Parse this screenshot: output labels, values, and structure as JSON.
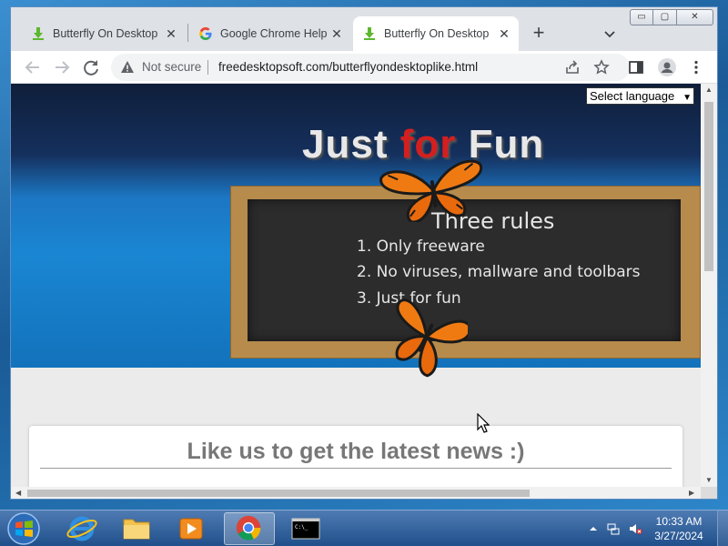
{
  "browser": {
    "tabs": [
      {
        "title": "Butterfly On Desktop on",
        "favicon": "download-icon",
        "active": false
      },
      {
        "title": "Google Chrome Help",
        "favicon": "google-icon",
        "active": false
      },
      {
        "title": "Butterfly On Desktop",
        "favicon": "download-icon",
        "active": true
      }
    ],
    "new_tab": "+",
    "window_buttons": {
      "minimize": "▭",
      "maximize": "▢",
      "close": "✕"
    },
    "security_label": "Not secure",
    "url": "freedesktopsoft.com/butterflyondesktoplike.html"
  },
  "page": {
    "language_select": "Select language",
    "banner_title_pre": "Just ",
    "banner_title_red": "for",
    "banner_title_post": " Fun",
    "board_heading": "Three rules",
    "rules": [
      "1. Only freeware",
      "2. No viruses, mallware and toolbars",
      "3. Just for fun"
    ],
    "like_heading": "Like us to get the latest news :)"
  },
  "taskbar": {
    "time": "10:33 AM",
    "date": "3/27/2024",
    "apps": [
      "internet-explorer-icon",
      "file-explorer-icon",
      "media-player-icon",
      "chrome-icon",
      "command-prompt-icon"
    ]
  },
  "colors": {
    "tabstrip": "#dee1e6",
    "accent_red": "#d41f1f",
    "banner_blue": "#1a86d3",
    "butterfly_orange": "#f07a12"
  }
}
